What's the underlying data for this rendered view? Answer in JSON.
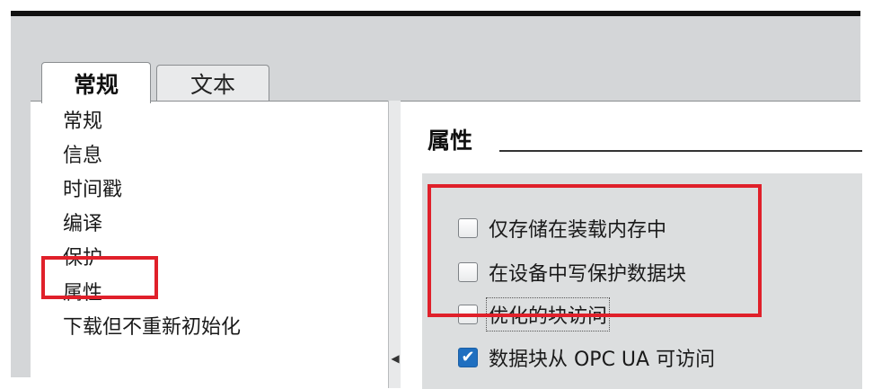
{
  "tabs": [
    {
      "label": "常规"
    },
    {
      "label": "文本"
    }
  ],
  "nav": {
    "items": [
      {
        "label": "常规"
      },
      {
        "label": "信息"
      },
      {
        "label": "时间戳"
      },
      {
        "label": "编译"
      },
      {
        "label": "保护"
      },
      {
        "label": "属性"
      },
      {
        "label": "下载但不重新初始化"
      }
    ],
    "selected": "属性"
  },
  "section": {
    "title": "属性"
  },
  "properties": [
    {
      "label": "仅存储在装载内存中",
      "checked": false
    },
    {
      "label": "在设备中写保护数据块",
      "checked": false
    },
    {
      "label": "优化的块访问",
      "checked": false
    },
    {
      "label": "数据块从 OPC UA 可访问",
      "checked": true
    }
  ],
  "icons": {
    "checkmark": "checkmark-icon",
    "splitter_arrow": "triangle-left-icon"
  },
  "colors": {
    "highlight": "#e0202a",
    "checkbox_checked": "#1f6fc0"
  }
}
